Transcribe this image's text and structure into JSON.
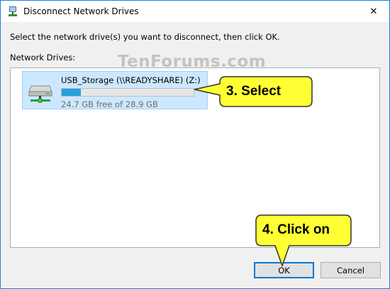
{
  "window": {
    "title": "Disconnect Network Drives",
    "close_glyph": "✕",
    "accent_color": "#1883d7"
  },
  "instruction": "Select the network drive(s) you want to disconnect, then click OK.",
  "list_label": "Network Drives:",
  "watermark": "TenForums.com",
  "drives": [
    {
      "name": "USB_Storage (\\\\READYSHARE) (Z:)",
      "free_text": "24.7 GB free of 28.9 GB",
      "used_fraction": 0.145,
      "icon": "network-drive-icon",
      "selected": true
    }
  ],
  "buttons": {
    "ok": "OK",
    "cancel": "Cancel"
  },
  "callouts": {
    "select": "3. Select",
    "click": "4. Click on",
    "fill_color": "#ffff33"
  }
}
